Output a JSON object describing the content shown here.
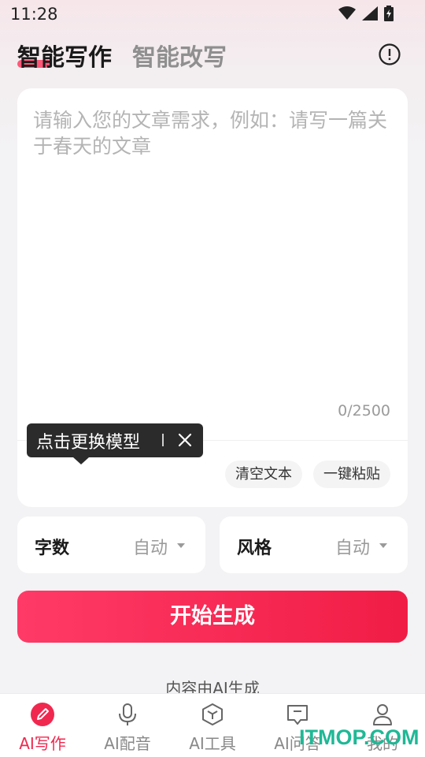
{
  "status_bar": {
    "time": "11:28"
  },
  "tabs": [
    {
      "label": "智能写作",
      "active": true
    },
    {
      "label": "智能改写",
      "active": false
    }
  ],
  "editor": {
    "placeholder": "请输入您的文章需求，例如：请写一篇关于春天的文章",
    "value": "",
    "counter": "0/2500"
  },
  "actions": {
    "clear_label": "清空文本",
    "paste_label": "一键粘贴"
  },
  "tooltip": {
    "text": "点击更换模型"
  },
  "options": [
    {
      "label": "字数",
      "value": "自动"
    },
    {
      "label": "风格",
      "value": "自动"
    }
  ],
  "generate_button": {
    "label": "开始生成"
  },
  "ai_note": "内容由AI生成",
  "bottom_nav": {
    "items": [
      {
        "label": "AI写作",
        "icon": "pen-icon",
        "active": true
      },
      {
        "label": "AI配音",
        "icon": "microphone-icon",
        "active": false
      },
      {
        "label": "AI工具",
        "icon": "cube-icon",
        "active": false
      },
      {
        "label": "AI问答",
        "icon": "chat-icon",
        "active": false
      },
      {
        "label": "我的",
        "icon": "user-icon",
        "active": false
      }
    ]
  },
  "watermark": "ITMOP.COM",
  "colors": {
    "accent": "#f0284f",
    "tooltip_bg": "#2b2b2b",
    "watermark": "#1fb896"
  }
}
